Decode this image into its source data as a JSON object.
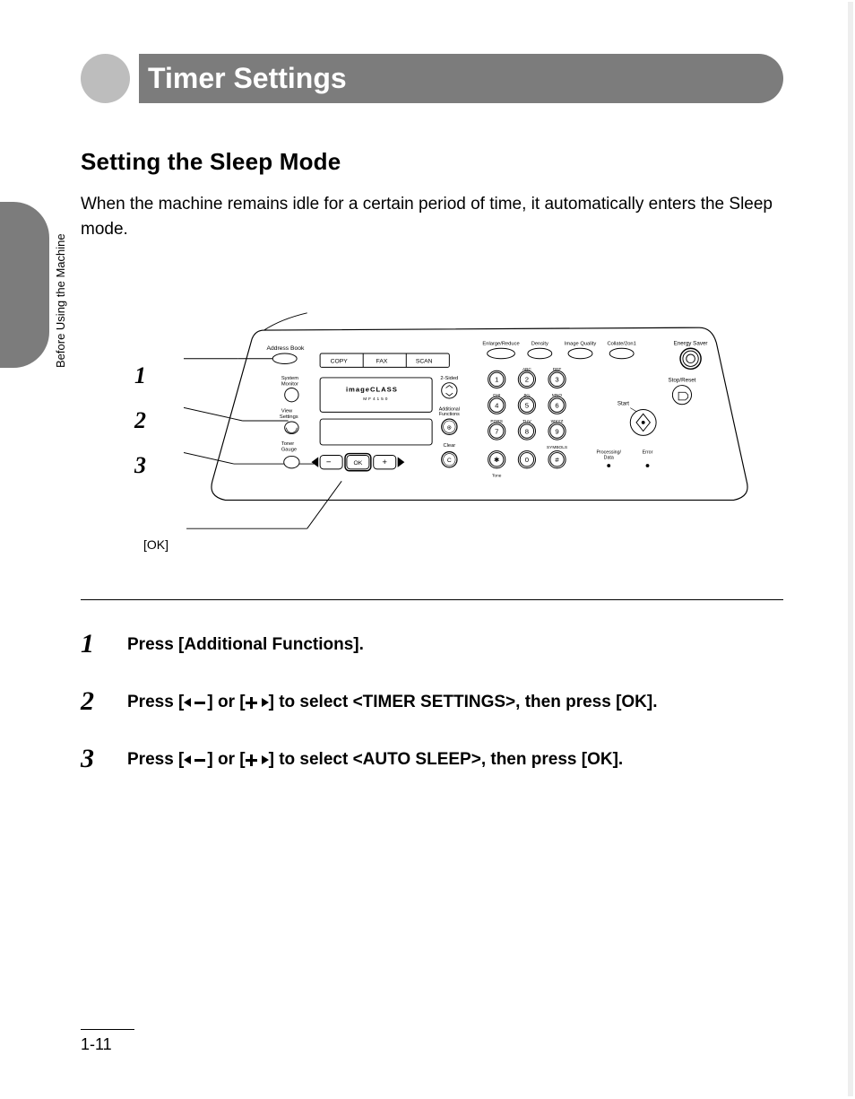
{
  "side_label": "Before Using the Machine",
  "title": "Timer Settings",
  "section_title": "Setting the Sleep Mode",
  "body_text": "When the machine remains idle for a certain period of time, it automatically enters the Sleep mode.",
  "diagram": {
    "callouts": [
      "1",
      "2",
      "3"
    ],
    "ok_label": "[OK]",
    "labels": {
      "address_book": "Address Book",
      "copy": "COPY",
      "fax": "FAX",
      "scan": "SCAN",
      "system_monitor": "System\nMonitor",
      "view_settings": "View\nSettings",
      "toner_gauge": "Toner\nGauge",
      "image_class": "imageCLASS",
      "model": "MF4150",
      "ok": "OK",
      "minus": "−",
      "plus": "+",
      "enlarge_reduce": "Enlarge/Reduce",
      "density": "Density",
      "image_quality": "Image Quality",
      "collate": "Collate/2on1",
      "two_sided": "2-Sided",
      "additional_functions": "Additional\nFunctions",
      "clear": "Clear",
      "clear_key": "C",
      "energy_saver": "Energy Saver",
      "stop_reset": "Stop/Reset",
      "start": "Start",
      "processing": "Processing/\nData",
      "error": "Error",
      "tone": "Tone",
      "abc": "ABC",
      "def": "DEF",
      "ghi": "GHI",
      "jkl": "JKL",
      "mno": "MNO",
      "pqrs": "PQRS",
      "tuv": "TUV",
      "wxyz": "WXYZ",
      "symbols": "SYMBOLS",
      "k1": "1",
      "k2": "2",
      "k3": "3",
      "k4": "4",
      "k5": "5",
      "k6": "6",
      "k7": "7",
      "k8": "8",
      "k9": "9",
      "k0": "0",
      "star": "✱",
      "hash": "#"
    }
  },
  "steps": [
    {
      "num": "1",
      "text_before": "Press [Additional Functions].",
      "select": "",
      "text_after": ""
    },
    {
      "num": "2",
      "text_before": "Press [",
      "select_pre": "] or [",
      "select_post": "] to select <TIMER SETTINGS>, then press [OK]."
    },
    {
      "num": "3",
      "text_before": "Press [",
      "select_pre": "] or [",
      "select_post": "] to select <AUTO SLEEP>, then press [OK]."
    }
  ],
  "page_number": "1-11"
}
